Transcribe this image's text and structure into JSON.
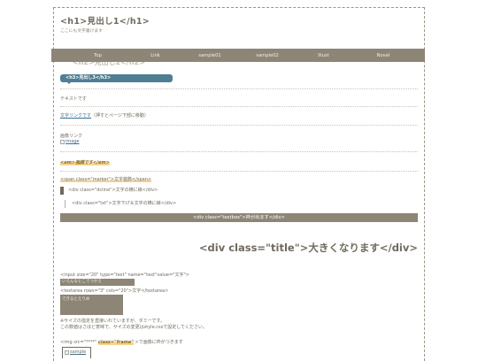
{
  "header": {
    "h1": "<h1>見出し1</h1>",
    "subtext": "ここにも文字書けます"
  },
  "nav": {
    "items": [
      "Top",
      "Link",
      "sample01",
      "sample02",
      "Illust",
      "Novel"
    ]
  },
  "ghost_h2": "<h2>見出し2</h2>",
  "h3": "<h3>見出し3</h3>",
  "text_line": "テキストです",
  "text_link": {
    "link": "文字リンクです",
    "note": "（押すとページ下部に移動）"
  },
  "image_link": {
    "label": "画像リンク",
    "alt": "image"
  },
  "em_text": "<em>強調です</em>",
  "marker_text": "<span class=\"marker\">文字装飾</span>",
  "dcline_text": "<div class=\"dcline\">文字の横に線</div>",
  "txt_text": "<div class=\"txt\">文字下げ＆文字の横に線</div>",
  "textbox_text": "<div class=\"textbox\">枠が出ます</div>",
  "title_big": "<div class=\"title\">大きくなります</div>",
  "form": {
    "input_code": "<input size=\"20\" type=\"text\" name=\"text\"value=\"文字\">",
    "input_value": "いろんなとこでつかえ",
    "textarea_code": "<textarea rows=\"3\" cols=\"20\">文字</textarea>",
    "textarea_value": "できるとえりめ",
    "note_1": "※サイズの指定を直接いれていますが、ダミーです。",
    "note_2": "この数値はさほど意味で、サイズの変更はstyle.cssで設定してください。"
  },
  "img_frame": {
    "code_prefix": "<img src=\"****\"",
    "code_class": "class=\"frame\"",
    "code_suffix": ">で画像に枠がつきます",
    "alt": "sample"
  }
}
